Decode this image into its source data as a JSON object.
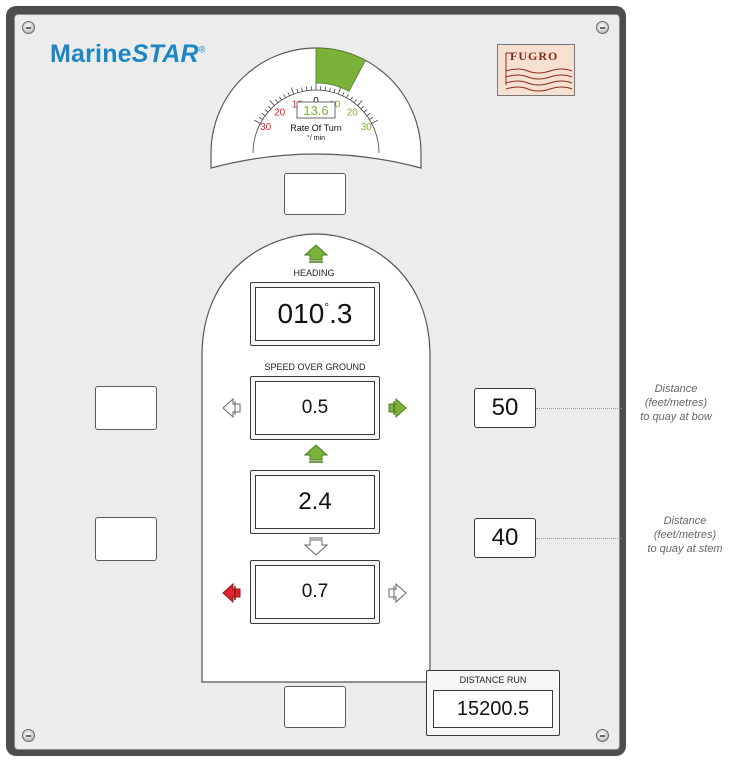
{
  "brand": {
    "name_plain": "Marine",
    "name_star": "STAR",
    "mark": "®"
  },
  "logo": {
    "text": "FUGRO"
  },
  "rate_of_turn": {
    "value": "13.6",
    "title": "Rate Of Turn",
    "unit": "°/ min",
    "scale_left": [
      "0",
      "10",
      "20",
      "30"
    ],
    "scale_right": [
      "10",
      "20",
      "30"
    ],
    "highlight_from": 0,
    "highlight_to": 13.6,
    "port_color": "#d9262c",
    "starboard_color": "#7bb33a"
  },
  "heading": {
    "label": "HEADING",
    "value": "010",
    "deg": "°",
    "decimal": ".3"
  },
  "speed": {
    "label": "SPEED OVER GROUND",
    "value": "0.5"
  },
  "fore_aft": {
    "value": "2.4"
  },
  "lateral": {
    "value": "0.7"
  },
  "bow_distance": {
    "value": "50",
    "note": [
      "Distance",
      "(feet/metres)",
      "to quay at bow"
    ]
  },
  "stern_distance": {
    "value": "40",
    "note": [
      "Distance",
      "(feet/metres)",
      "to quay at stem"
    ]
  },
  "distance_run": {
    "label": "DISTANCE RUN",
    "value": "15200.5"
  },
  "colors": {
    "brand": "#1d86c4",
    "active_green": "#7bb33a",
    "active_red": "#d9262c"
  },
  "icons": [
    "screw-icon",
    "arrow-up-icon",
    "arrow-down-icon",
    "arrow-left-icon",
    "arrow-right-icon"
  ]
}
